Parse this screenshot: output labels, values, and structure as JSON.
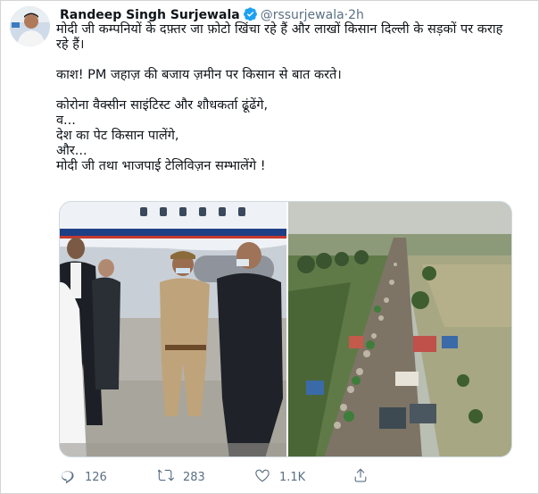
{
  "tweet": {
    "author_name": "Randeep Singh Surjewala",
    "handle": "@rssurjewala",
    "separator": "·",
    "time": "2h",
    "text_lines": [
      "मोदी जी कम्पनियों के दफ़्तर जा फ़ोटो खिंचा रहे हैं और लाखों किसान दिल्ली के सड़कों पर कराह रहे हैं।",
      "काश! PM जहाज़ की बजाय ज़मीन पर किसान से बात करते।",
      "कोरोना वैक्सीन साइंटिस्ट और शौधकर्ता ढूंढेंगे,\nव...\nदेश का पेट किसान पालेंगे,\nऔर...\nमोदी जी तथा भाजपाई टेलिविज़न सम्भालेंगे !"
    ]
  },
  "actions": {
    "reply_count": "126",
    "retweet_count": "283",
    "like_count": "1.1K"
  },
  "icons": {
    "verified": "verified-badge-icon",
    "reply": "reply-icon",
    "retweet": "retweet-icon",
    "like": "heart-icon",
    "share": "share-icon"
  },
  "colors": {
    "verified": "#1da1f2",
    "secondary_text": "#5b7083",
    "primary_text": "#0f1419"
  }
}
